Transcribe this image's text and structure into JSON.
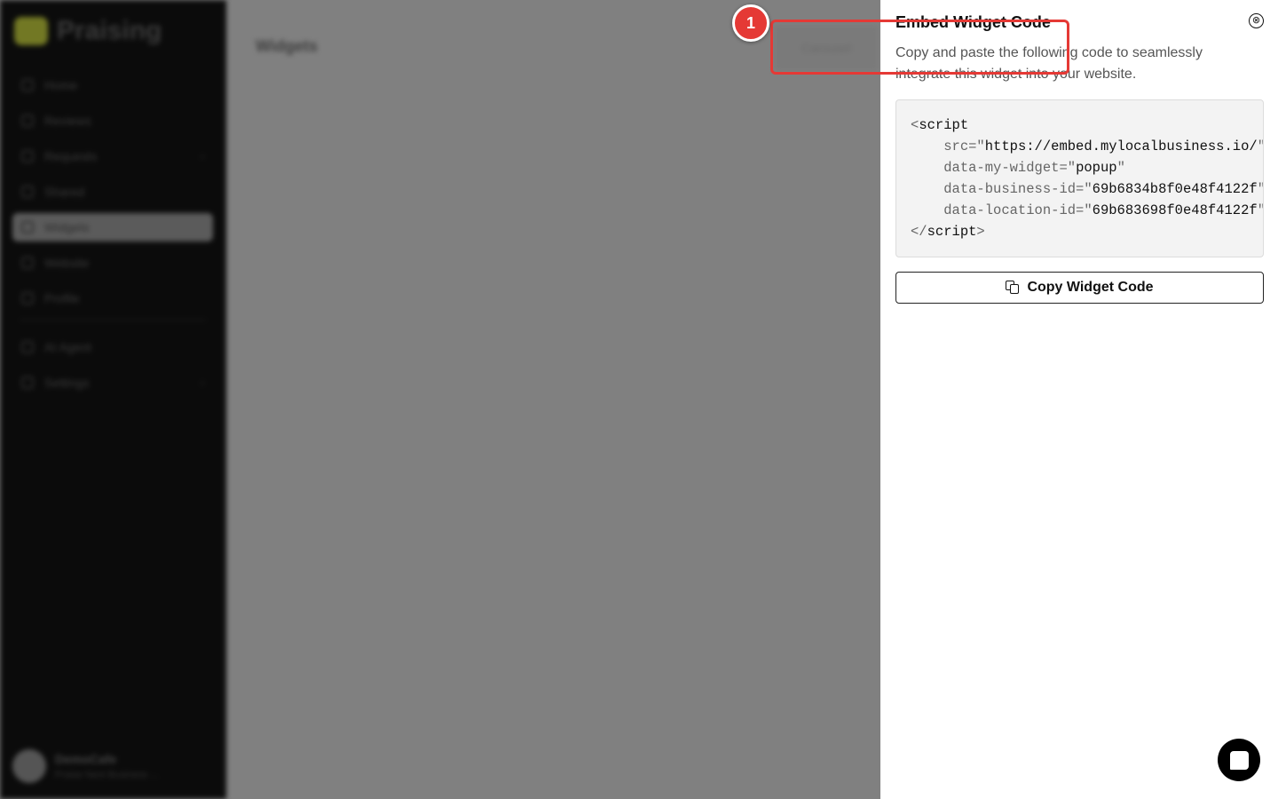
{
  "sidebar": {
    "brand": "Praising",
    "items": [
      {
        "label": "Home"
      },
      {
        "label": "Reviews"
      },
      {
        "label": "Requests",
        "chevron": "›"
      },
      {
        "label": "Shared"
      },
      {
        "label": "Widgets"
      },
      {
        "label": "Website"
      },
      {
        "label": "Profile"
      }
    ],
    "items2": [
      {
        "label": "AI Agent"
      },
      {
        "label": "Settings",
        "chevron": "›"
      }
    ],
    "user": {
      "name": "DemoCafe",
      "subtitle": "Praise Next Business ..."
    }
  },
  "main": {
    "title": "Widgets",
    "button": "Carousel"
  },
  "drawer": {
    "title": "Embed Widget Code",
    "close_icon": "⊗",
    "description": "Copy and paste the following code to seamlessly integrate this widget into your website.",
    "code": {
      "open_tag": "script",
      "attrs": [
        {
          "name": "src",
          "value": "https://embed.mylocalbusiness.io/"
        },
        {
          "name": "data-my-widget",
          "value": "popup"
        },
        {
          "name": "data-business-id",
          "value": "69b6834b8f0e48f4122f"
        },
        {
          "name": "data-location-id",
          "value": "69b683698f0e48f4122f"
        }
      ],
      "close_tag": "script"
    },
    "copy_button": "Copy Widget Code"
  },
  "annotation": {
    "number": "1",
    "color": "#e53935"
  }
}
